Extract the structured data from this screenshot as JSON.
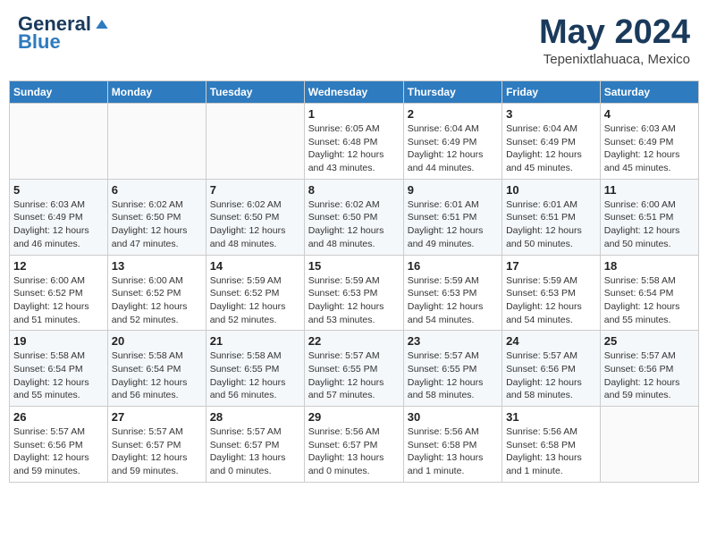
{
  "header": {
    "logo_line1": "General",
    "logo_line2": "Blue",
    "month_title": "May 2024",
    "location": "Tepenixtlahuaca, Mexico"
  },
  "weekdays": [
    "Sunday",
    "Monday",
    "Tuesday",
    "Wednesday",
    "Thursday",
    "Friday",
    "Saturday"
  ],
  "weeks": [
    [
      {
        "day": "",
        "info": ""
      },
      {
        "day": "",
        "info": ""
      },
      {
        "day": "",
        "info": ""
      },
      {
        "day": "1",
        "info": "Sunrise: 6:05 AM\nSunset: 6:48 PM\nDaylight: 12 hours\nand 43 minutes."
      },
      {
        "day": "2",
        "info": "Sunrise: 6:04 AM\nSunset: 6:49 PM\nDaylight: 12 hours\nand 44 minutes."
      },
      {
        "day": "3",
        "info": "Sunrise: 6:04 AM\nSunset: 6:49 PM\nDaylight: 12 hours\nand 45 minutes."
      },
      {
        "day": "4",
        "info": "Sunrise: 6:03 AM\nSunset: 6:49 PM\nDaylight: 12 hours\nand 45 minutes."
      }
    ],
    [
      {
        "day": "5",
        "info": "Sunrise: 6:03 AM\nSunset: 6:49 PM\nDaylight: 12 hours\nand 46 minutes."
      },
      {
        "day": "6",
        "info": "Sunrise: 6:02 AM\nSunset: 6:50 PM\nDaylight: 12 hours\nand 47 minutes."
      },
      {
        "day": "7",
        "info": "Sunrise: 6:02 AM\nSunset: 6:50 PM\nDaylight: 12 hours\nand 48 minutes."
      },
      {
        "day": "8",
        "info": "Sunrise: 6:02 AM\nSunset: 6:50 PM\nDaylight: 12 hours\nand 48 minutes."
      },
      {
        "day": "9",
        "info": "Sunrise: 6:01 AM\nSunset: 6:51 PM\nDaylight: 12 hours\nand 49 minutes."
      },
      {
        "day": "10",
        "info": "Sunrise: 6:01 AM\nSunset: 6:51 PM\nDaylight: 12 hours\nand 50 minutes."
      },
      {
        "day": "11",
        "info": "Sunrise: 6:00 AM\nSunset: 6:51 PM\nDaylight: 12 hours\nand 50 minutes."
      }
    ],
    [
      {
        "day": "12",
        "info": "Sunrise: 6:00 AM\nSunset: 6:52 PM\nDaylight: 12 hours\nand 51 minutes."
      },
      {
        "day": "13",
        "info": "Sunrise: 6:00 AM\nSunset: 6:52 PM\nDaylight: 12 hours\nand 52 minutes."
      },
      {
        "day": "14",
        "info": "Sunrise: 5:59 AM\nSunset: 6:52 PM\nDaylight: 12 hours\nand 52 minutes."
      },
      {
        "day": "15",
        "info": "Sunrise: 5:59 AM\nSunset: 6:53 PM\nDaylight: 12 hours\nand 53 minutes."
      },
      {
        "day": "16",
        "info": "Sunrise: 5:59 AM\nSunset: 6:53 PM\nDaylight: 12 hours\nand 54 minutes."
      },
      {
        "day": "17",
        "info": "Sunrise: 5:59 AM\nSunset: 6:53 PM\nDaylight: 12 hours\nand 54 minutes."
      },
      {
        "day": "18",
        "info": "Sunrise: 5:58 AM\nSunset: 6:54 PM\nDaylight: 12 hours\nand 55 minutes."
      }
    ],
    [
      {
        "day": "19",
        "info": "Sunrise: 5:58 AM\nSunset: 6:54 PM\nDaylight: 12 hours\nand 55 minutes."
      },
      {
        "day": "20",
        "info": "Sunrise: 5:58 AM\nSunset: 6:54 PM\nDaylight: 12 hours\nand 56 minutes."
      },
      {
        "day": "21",
        "info": "Sunrise: 5:58 AM\nSunset: 6:55 PM\nDaylight: 12 hours\nand 56 minutes."
      },
      {
        "day": "22",
        "info": "Sunrise: 5:57 AM\nSunset: 6:55 PM\nDaylight: 12 hours\nand 57 minutes."
      },
      {
        "day": "23",
        "info": "Sunrise: 5:57 AM\nSunset: 6:55 PM\nDaylight: 12 hours\nand 58 minutes."
      },
      {
        "day": "24",
        "info": "Sunrise: 5:57 AM\nSunset: 6:56 PM\nDaylight: 12 hours\nand 58 minutes."
      },
      {
        "day": "25",
        "info": "Sunrise: 5:57 AM\nSunset: 6:56 PM\nDaylight: 12 hours\nand 59 minutes."
      }
    ],
    [
      {
        "day": "26",
        "info": "Sunrise: 5:57 AM\nSunset: 6:56 PM\nDaylight: 12 hours\nand 59 minutes."
      },
      {
        "day": "27",
        "info": "Sunrise: 5:57 AM\nSunset: 6:57 PM\nDaylight: 12 hours\nand 59 minutes."
      },
      {
        "day": "28",
        "info": "Sunrise: 5:57 AM\nSunset: 6:57 PM\nDaylight: 13 hours\nand 0 minutes."
      },
      {
        "day": "29",
        "info": "Sunrise: 5:56 AM\nSunset: 6:57 PM\nDaylight: 13 hours\nand 0 minutes."
      },
      {
        "day": "30",
        "info": "Sunrise: 5:56 AM\nSunset: 6:58 PM\nDaylight: 13 hours\nand 1 minute."
      },
      {
        "day": "31",
        "info": "Sunrise: 5:56 AM\nSunset: 6:58 PM\nDaylight: 13 hours\nand 1 minute."
      },
      {
        "day": "",
        "info": ""
      }
    ]
  ]
}
